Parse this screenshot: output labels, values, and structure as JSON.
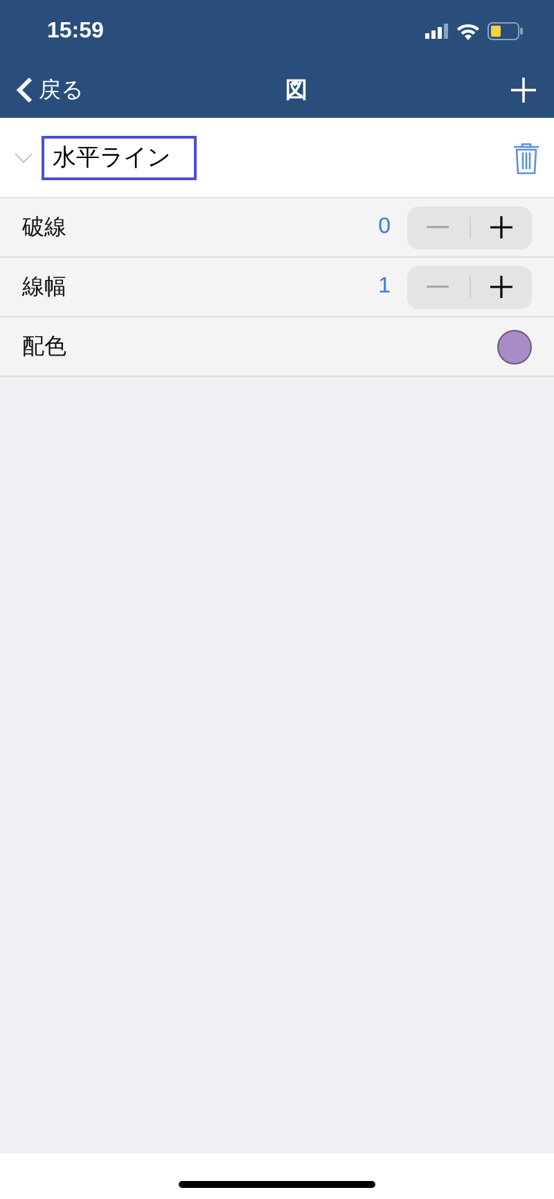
{
  "status_bar": {
    "time": "15:59"
  },
  "nav_bar": {
    "back": "戻る",
    "title": "図"
  },
  "figure": {
    "name": "水平ライン"
  },
  "properties": [
    {
      "kind": "stepper",
      "label": "破線",
      "value": "0",
      "decrement_disabled": true
    },
    {
      "kind": "stepper",
      "label": "線幅",
      "value": "1",
      "decrement_disabled": true
    },
    {
      "kind": "color",
      "label": "配色",
      "color": "#a98bc5"
    }
  ]
}
